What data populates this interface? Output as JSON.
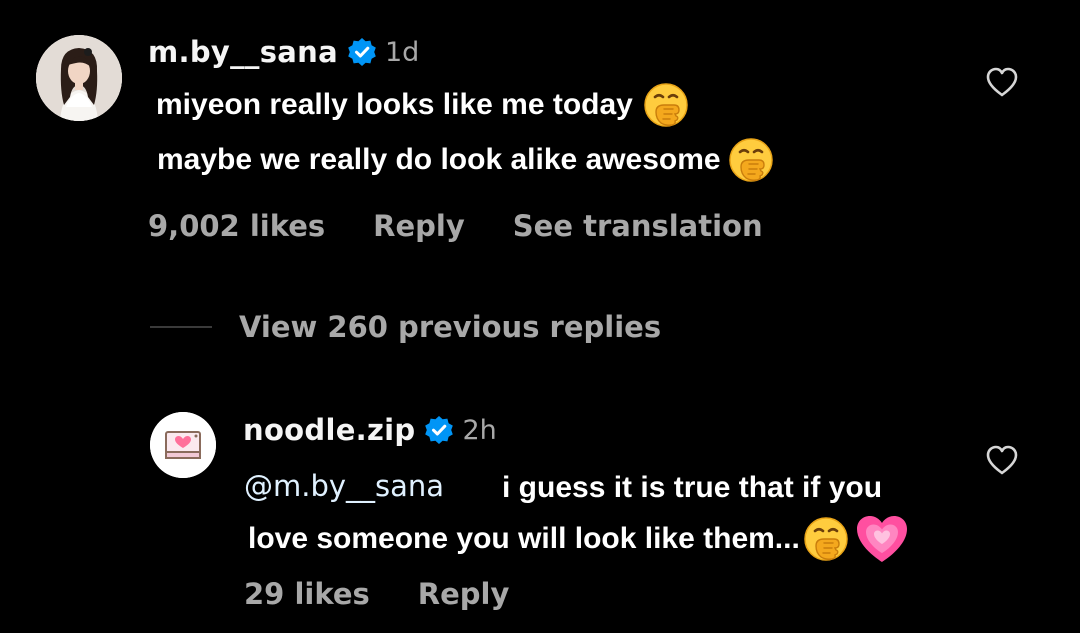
{
  "comment": {
    "username": "m.by__sana",
    "verified": true,
    "timestamp": "1d",
    "avatar_icon": "profile-photo",
    "text_line_1": "miyeon really looks like me today",
    "text_line_2": "maybe we really do look alike awesome",
    "emoji": "face-with-hand-over-mouth",
    "likes": "9,002 likes",
    "reply_label": "Reply",
    "translate_label": "See translation"
  },
  "view_replies": {
    "label": "View 260 previous replies"
  },
  "reply": {
    "username": "noodle.zip",
    "verified": true,
    "timestamp": "2h",
    "avatar_icon": "heart-envelope-logo",
    "mention": "@m.by__sana",
    "text_line_1": "i guess it is true that if you",
    "text_line_2": "love someone you will look like them...",
    "emojis": [
      "face-with-hand-over-mouth",
      "growing-heart"
    ],
    "likes": "29 likes",
    "reply_label": "Reply"
  },
  "colors": {
    "background": "#000000",
    "primary_text": "#f5f5f5",
    "secondary_text": "#a8a8a8",
    "verified_badge": "#0095f6",
    "mention": "#e0f1ff"
  }
}
